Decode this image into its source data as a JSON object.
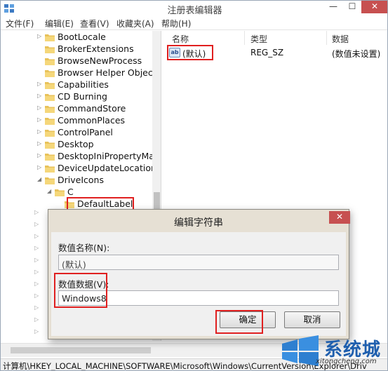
{
  "window": {
    "title": "注册表编辑器"
  },
  "menu": [
    "文件(F)",
    "编辑(E)",
    "查看(V)",
    "收藏夹(A)",
    "帮助(H)"
  ],
  "tree": {
    "items": [
      {
        "label": "BootLocale",
        "expander": "▷"
      },
      {
        "label": "BrokerExtensions",
        "expander": ""
      },
      {
        "label": "BrowseNewProcess",
        "expander": ""
      },
      {
        "label": "Browser Helper Objects",
        "expander": ""
      },
      {
        "label": "Capabilities",
        "expander": "▷"
      },
      {
        "label": "CD Burning",
        "expander": "▷"
      },
      {
        "label": "CommandStore",
        "expander": "▷"
      },
      {
        "label": "CommonPlaces",
        "expander": "▷"
      },
      {
        "label": "ControlPanel",
        "expander": "▷"
      },
      {
        "label": "Desktop",
        "expander": "▷"
      },
      {
        "label": "DesktopIniPropertyMap",
        "expander": "▷"
      },
      {
        "label": "DeviceUpdateLocations",
        "expander": "▷"
      },
      {
        "label": "DriveIcons",
        "expander": "◢"
      },
      {
        "label": "C",
        "expander": "◢"
      },
      {
        "label": "DefaultLabel",
        "expander": ""
      }
    ]
  },
  "values": {
    "headers": {
      "name": "名称",
      "type": "类型",
      "data": "数据"
    },
    "rows": [
      {
        "icon": "ab",
        "name": "(默认)",
        "type": "REG_SZ",
        "data": "(数值未设置)"
      }
    ]
  },
  "dialog": {
    "title": "编辑字符串",
    "name_label": "数值名称(N):",
    "name_value": "(默认)",
    "data_label": "数值数据(V):",
    "data_value": "Windows8",
    "ok_label": "确定",
    "cancel_label": "取消"
  },
  "statusbar": {
    "path": "计算机\\HKEY_LOCAL_MACHINE\\SOFTWARE\\Microsoft\\Windows\\CurrentVersion\\Explorer\\Driv"
  },
  "watermark": {
    "text": "系统城",
    "url": "xitongcheng.com"
  },
  "colors": {
    "highlight": "#e02020",
    "close": "#c75050",
    "dialog_bg": "#e6e0d4"
  }
}
